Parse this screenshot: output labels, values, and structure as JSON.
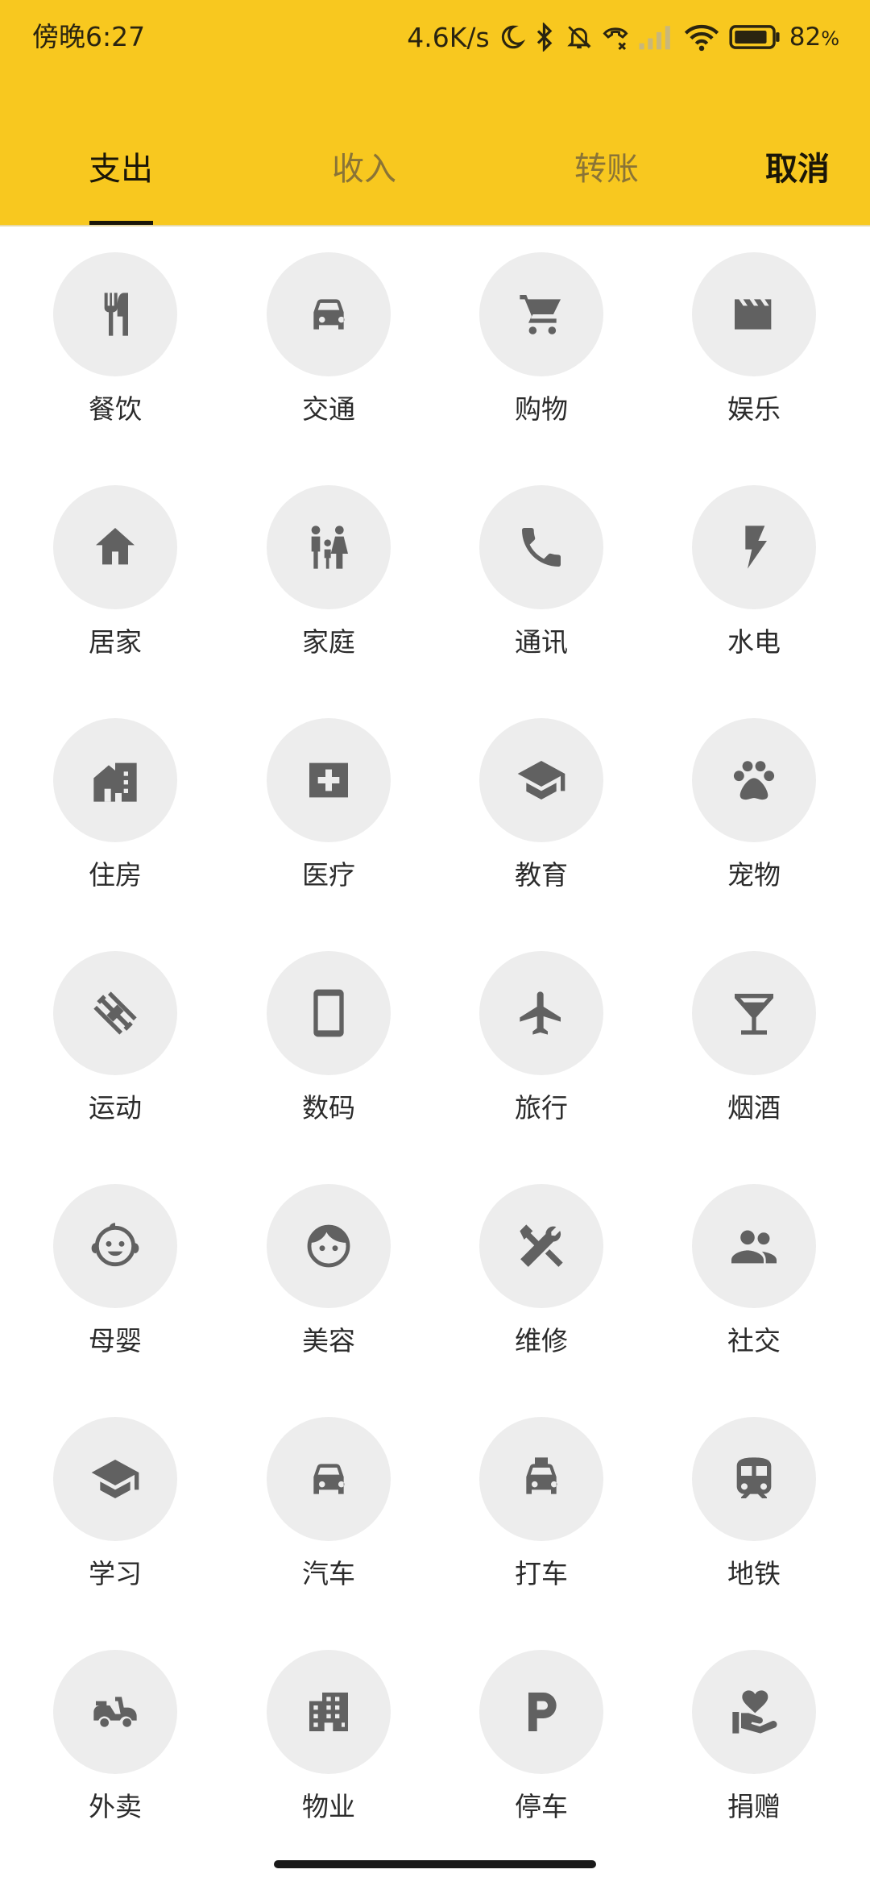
{
  "status_bar": {
    "time": "傍晚6:27",
    "network_speed": "4.6K/s",
    "battery_percent": "82",
    "battery_suffix": "%",
    "icons": [
      "moon-icon",
      "bluetooth-icon",
      "mute-icon",
      "call-icon",
      "signal-icon",
      "wifi-icon",
      "battery-icon"
    ]
  },
  "tabs": [
    {
      "label": "支出",
      "active": true
    },
    {
      "label": "收入",
      "active": false
    },
    {
      "label": "转账",
      "active": false
    }
  ],
  "cancel_label": "取消",
  "colors": {
    "header": "#f8c81f",
    "icon_circle": "#ededed",
    "icon": "#616161",
    "text": "#2b2b2b"
  },
  "categories": [
    {
      "label": "餐饮",
      "icon": "restaurant"
    },
    {
      "label": "交通",
      "icon": "car"
    },
    {
      "label": "购物",
      "icon": "cart"
    },
    {
      "label": "娱乐",
      "icon": "movie"
    },
    {
      "label": "居家",
      "icon": "home"
    },
    {
      "label": "家庭",
      "icon": "family"
    },
    {
      "label": "通讯",
      "icon": "phone"
    },
    {
      "label": "水电",
      "icon": "bolt"
    },
    {
      "label": "住房",
      "icon": "house"
    },
    {
      "label": "医疗",
      "icon": "medical"
    },
    {
      "label": "教育",
      "icon": "school"
    },
    {
      "label": "宠物",
      "icon": "paw"
    },
    {
      "label": "运动",
      "icon": "dumbbell"
    },
    {
      "label": "数码",
      "icon": "smartphone"
    },
    {
      "label": "旅行",
      "icon": "airplane"
    },
    {
      "label": "烟酒",
      "icon": "cocktail"
    },
    {
      "label": "母婴",
      "icon": "baby"
    },
    {
      "label": "美容",
      "icon": "face"
    },
    {
      "label": "维修",
      "icon": "repair"
    },
    {
      "label": "社交",
      "icon": "people"
    },
    {
      "label": "学习",
      "icon": "school"
    },
    {
      "label": "汽车",
      "icon": "car"
    },
    {
      "label": "打车",
      "icon": "taxi"
    },
    {
      "label": "地铁",
      "icon": "subway"
    },
    {
      "label": "外卖",
      "icon": "scooter"
    },
    {
      "label": "物业",
      "icon": "building"
    },
    {
      "label": "停车",
      "icon": "parking"
    },
    {
      "label": "捐赠",
      "icon": "donate"
    }
  ]
}
